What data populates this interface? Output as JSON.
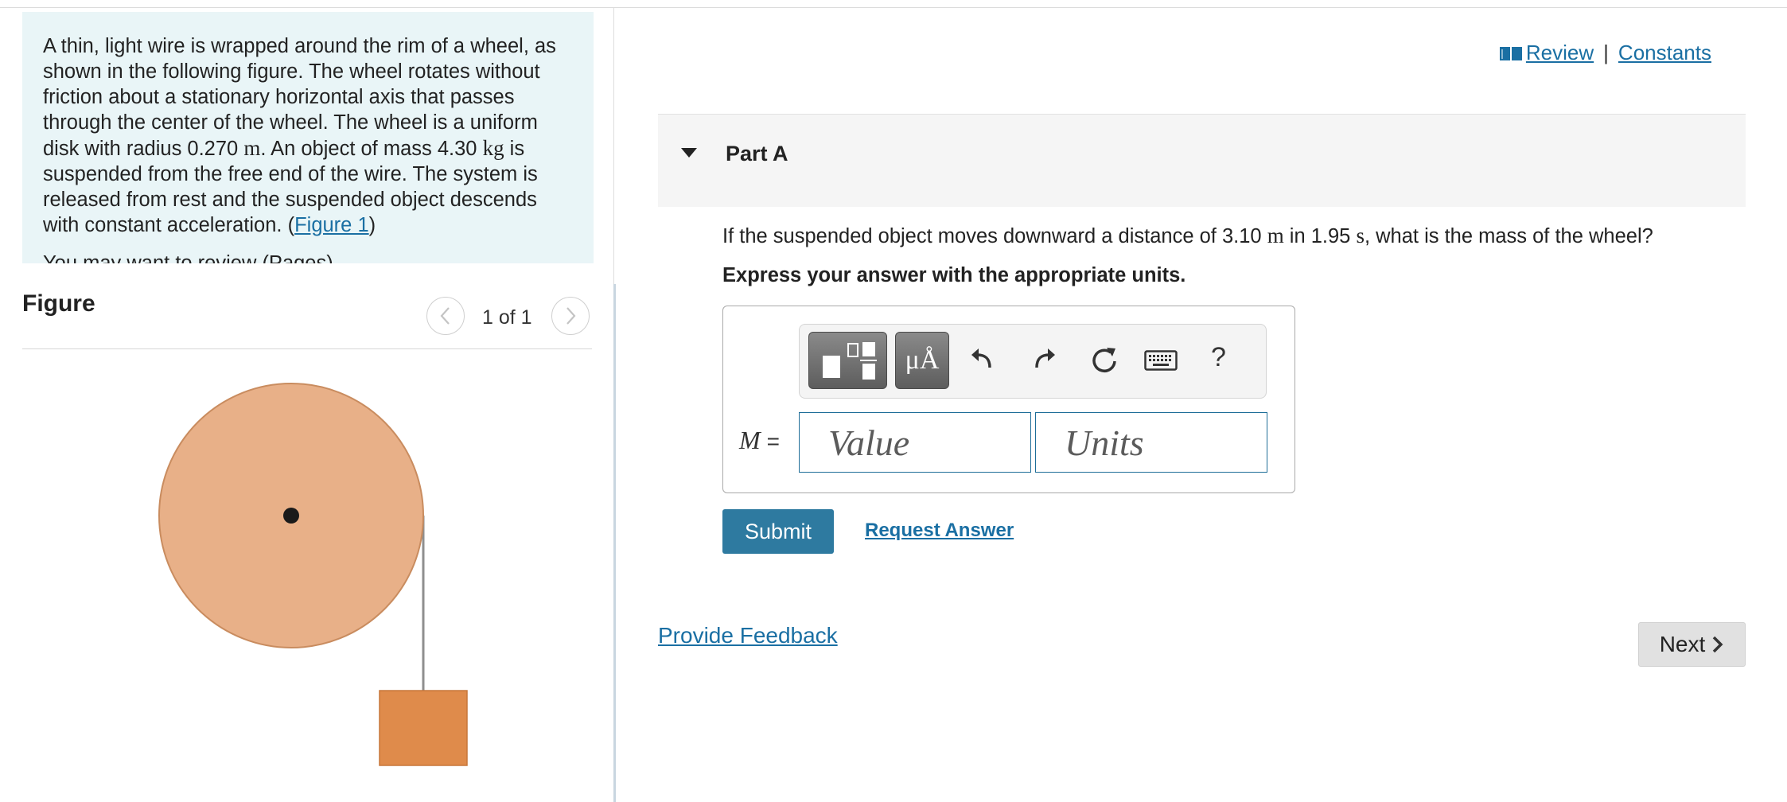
{
  "problem": {
    "text_1": "A thin, light wire is wrapped around the rim of a wheel, as shown in the following figure. The wheel rotates without friction about a stationary horizontal axis that passes through the center of the wheel. The wheel is a uniform disk with radius 0.270 ",
    "unit_m": "m",
    "text_2": ". An object of mass 4.30 ",
    "unit_kg": "kg",
    "text_3": " is suspended from the free end of the wire. The system is released from rest and the suspended object descends with constant acceleration. (",
    "figure_link": "Figure 1",
    "text_4": ")",
    "cut_line": "You may want to review (Pages)"
  },
  "figure": {
    "title": "Figure",
    "page_count": "1 of 1",
    "wheel_color": "#e8b088",
    "wheel_edge_color": "#c98c5f",
    "block_color": "#df8b4b",
    "wire_color": "#8f8f8f"
  },
  "header_links": {
    "review": "Review",
    "separator": "|",
    "constants": "Constants"
  },
  "part": {
    "title": "Part A",
    "question_1": "If the suspended object moves downward a distance of 3.10 ",
    "unit_m": "m",
    "question_2": " in 1.95 ",
    "unit_s": "s",
    "question_3": ", what is the mass of the wheel?",
    "instruction": "Express your answer with the appropriate units."
  },
  "answer": {
    "variable": "M",
    "equals": "=",
    "value_placeholder": "Value",
    "units_placeholder": "Units",
    "toolbar_units_label": "μÅ",
    "toolbar_help": "?"
  },
  "actions": {
    "submit": "Submit",
    "request_answer": "Request Answer",
    "provide_feedback": "Provide Feedback",
    "next": "Next"
  },
  "colors": {
    "accent": "#2e7aa0",
    "link": "#1a6fa3",
    "problem_bg": "#e9f5f7"
  }
}
